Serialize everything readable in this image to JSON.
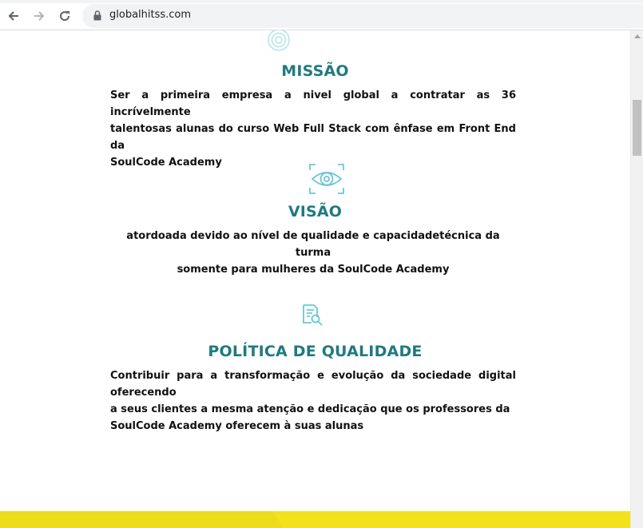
{
  "browser": {
    "url": "globalhitss.com",
    "icons": {
      "back": "arrow-left-icon",
      "forward": "arrow-right-icon",
      "reload": "reload-icon",
      "lock": "lock-icon"
    }
  },
  "sections": {
    "missao": {
      "icon": "target-icon",
      "title": "MISSÃO",
      "lines": [
        "Ser a primeira empresa a nivel global a contratar as 36 incrívelmente",
        "talentosas alunas do curso Web Full Stack com ênfase em Front End da",
        "SoulCode Academy"
      ]
    },
    "visao": {
      "icon": "eye-scan-icon",
      "title": "VISÃO",
      "lines": [
        "atordoada devido ao nível de qualidade e capacidadetécnica da turma",
        "somente para mulheres da SoulCode Academy"
      ]
    },
    "politica": {
      "icon": "document-search-icon",
      "title": "POLÍTICA DE QUALIDADE",
      "lines": [
        "Contribuir para a transformação e evolução da sociedade digital oferecendo",
        "a seus clientes a mesma atenção e dedicação que os professores da",
        "SoulCode Academy oferecem à suas alunas"
      ]
    }
  },
  "colors": {
    "heading": "#1f7a80",
    "icon": "#6cc7d8",
    "footer_band": "#f3e11b"
  }
}
